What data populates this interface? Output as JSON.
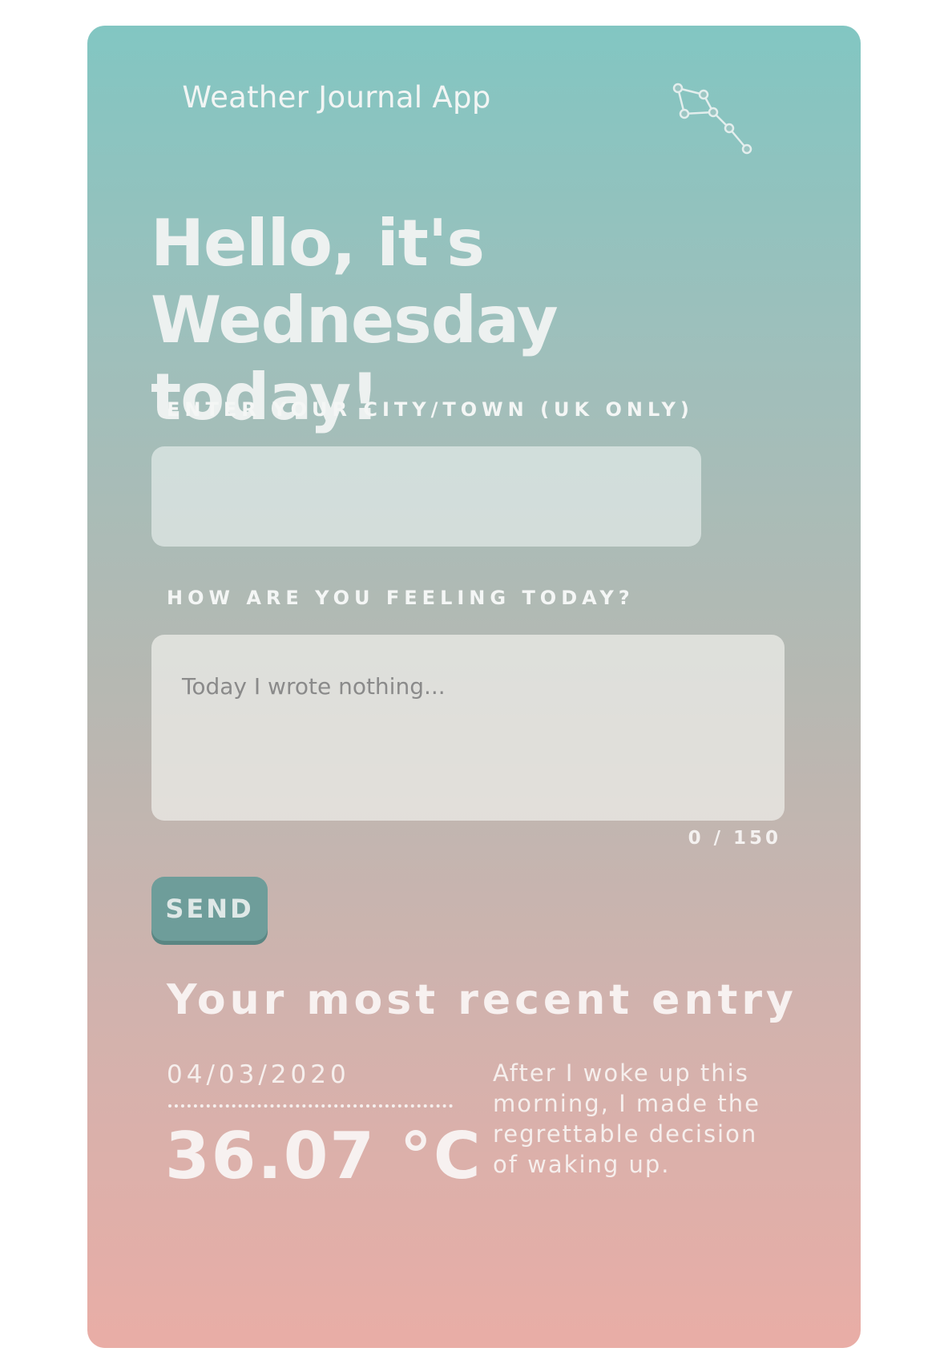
{
  "header": {
    "app_title": "Weather Journal App",
    "logo_icon": "constellation-icon"
  },
  "greeting": {
    "line1": "Hello, it's",
    "line2": "Wednesday today!"
  },
  "form": {
    "city_label": "ENTER YOUR CITY/TOWN (UK ONLY)",
    "city_value": "",
    "feelings_label": "HOW ARE YOU FEELING TODAY?",
    "feelings_value": "",
    "feelings_placeholder": "Today I wrote nothing...",
    "char_counter": "0 / 150",
    "send_label": "SEND"
  },
  "recent_entry": {
    "title": "Your most recent entry",
    "date": "04/03/2020",
    "temperature": "36.07 °C",
    "content": "After I woke up this morning, I made the regrettable decision of waking up."
  },
  "colors": {
    "gradient_top": "#82c6c2",
    "gradient_bottom": "#e9ada6",
    "button": "#6e9d9a"
  }
}
